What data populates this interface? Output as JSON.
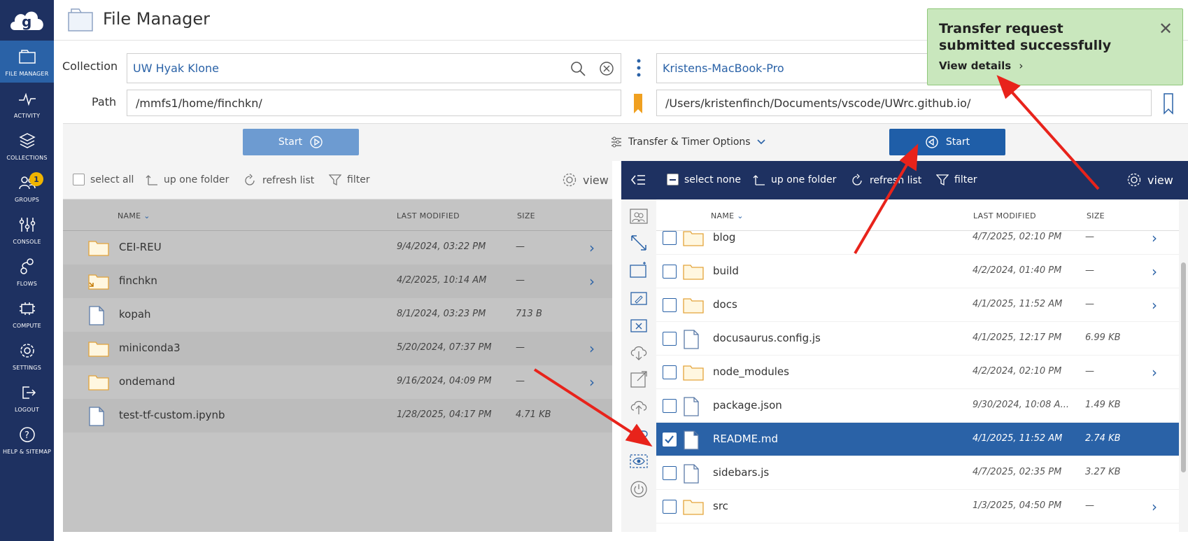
{
  "nav": {
    "items": [
      {
        "label": "FILE MANAGER",
        "icon": "folder-icon"
      },
      {
        "label": "ACTIVITY",
        "icon": "activity-icon"
      },
      {
        "label": "COLLECTIONS",
        "icon": "collections-icon"
      },
      {
        "label": "GROUPS",
        "icon": "groups-icon",
        "badge": "1"
      },
      {
        "label": "CONSOLE",
        "icon": "console-icon"
      },
      {
        "label": "FLOWS",
        "icon": "flows-icon"
      },
      {
        "label": "COMPUTE",
        "icon": "compute-icon"
      },
      {
        "label": "SETTINGS",
        "icon": "settings-icon"
      },
      {
        "label": "LOGOUT",
        "icon": "logout-icon"
      },
      {
        "label": "HELP & SITEMAP",
        "icon": "help-icon"
      }
    ]
  },
  "header": {
    "title": "File Manager"
  },
  "left": {
    "collection_label": "Collection",
    "collection": "UW Hyak Klone",
    "path_label": "Path",
    "path": "/mmfs1/home/finchkn/"
  },
  "right": {
    "collection": "Kristens-MacBook-Pro",
    "path": "/Users/kristenfinch/Documents/vscode/UWrc.github.io/"
  },
  "transfer": {
    "start_left": "Start",
    "options": "Transfer & Timer Options",
    "start_right": "Start"
  },
  "left_toolbar": {
    "select_all": "select all",
    "up": "up one folder",
    "refresh": "refresh list",
    "filter": "filter",
    "view": "view"
  },
  "right_toolbar": {
    "select_none": "select none",
    "up": "up one folder",
    "refresh": "refresh list",
    "filter": "filter",
    "view": "view"
  },
  "columns": {
    "name": "NAME",
    "modified": "LAST MODIFIED",
    "size": "SIZE"
  },
  "left_files": [
    {
      "name": "CEI-REU",
      "modified": "9/4/2024, 03:22 PM",
      "size": "—",
      "type": "folder"
    },
    {
      "name": "finchkn",
      "modified": "4/2/2025, 10:14 AM",
      "size": "—",
      "type": "folder-link"
    },
    {
      "name": "kopah",
      "modified": "8/1/2024, 03:23 PM",
      "size": "713 B",
      "type": "file"
    },
    {
      "name": "miniconda3",
      "modified": "5/20/2024, 07:37 PM",
      "size": "—",
      "type": "folder"
    },
    {
      "name": "ondemand",
      "modified": "9/16/2024, 04:09 PM",
      "size": "—",
      "type": "folder"
    },
    {
      "name": "test-tf-custom.ipynb",
      "modified": "1/28/2025, 04:17 PM",
      "size": "4.71 KB",
      "type": "file"
    }
  ],
  "right_files": [
    {
      "name": "blog",
      "modified": "4/7/2025, 02:10 PM",
      "size": "—",
      "type": "folder"
    },
    {
      "name": "build",
      "modified": "4/2/2024, 01:40 PM",
      "size": "—",
      "type": "folder"
    },
    {
      "name": "docs",
      "modified": "4/1/2025, 11:52 AM",
      "size": "—",
      "type": "folder"
    },
    {
      "name": "docusaurus.config.js",
      "modified": "4/1/2025, 12:17 PM",
      "size": "6.99 KB",
      "type": "file"
    },
    {
      "name": "node_modules",
      "modified": "4/2/2024, 02:10 PM",
      "size": "—",
      "type": "folder"
    },
    {
      "name": "package.json",
      "modified": "9/30/2024, 10:08 A...",
      "size": "1.49 KB",
      "type": "file"
    },
    {
      "name": "README.md",
      "modified": "4/1/2025, 11:52 AM",
      "size": "2.74 KB",
      "type": "file",
      "selected": true
    },
    {
      "name": "sidebars.js",
      "modified": "4/7/2025, 02:35 PM",
      "size": "3.27 KB",
      "type": "file"
    },
    {
      "name": "src",
      "modified": "1/3/2025, 04:50 PM",
      "size": "—",
      "type": "folder"
    }
  ],
  "toast": {
    "message": "Transfer request submitted successfully",
    "link": "View details"
  },
  "colors": {
    "nav": "#1e3161",
    "accent": "#2a62a7",
    "toast": "#c9e7bd",
    "arrow": "#e8231b"
  }
}
